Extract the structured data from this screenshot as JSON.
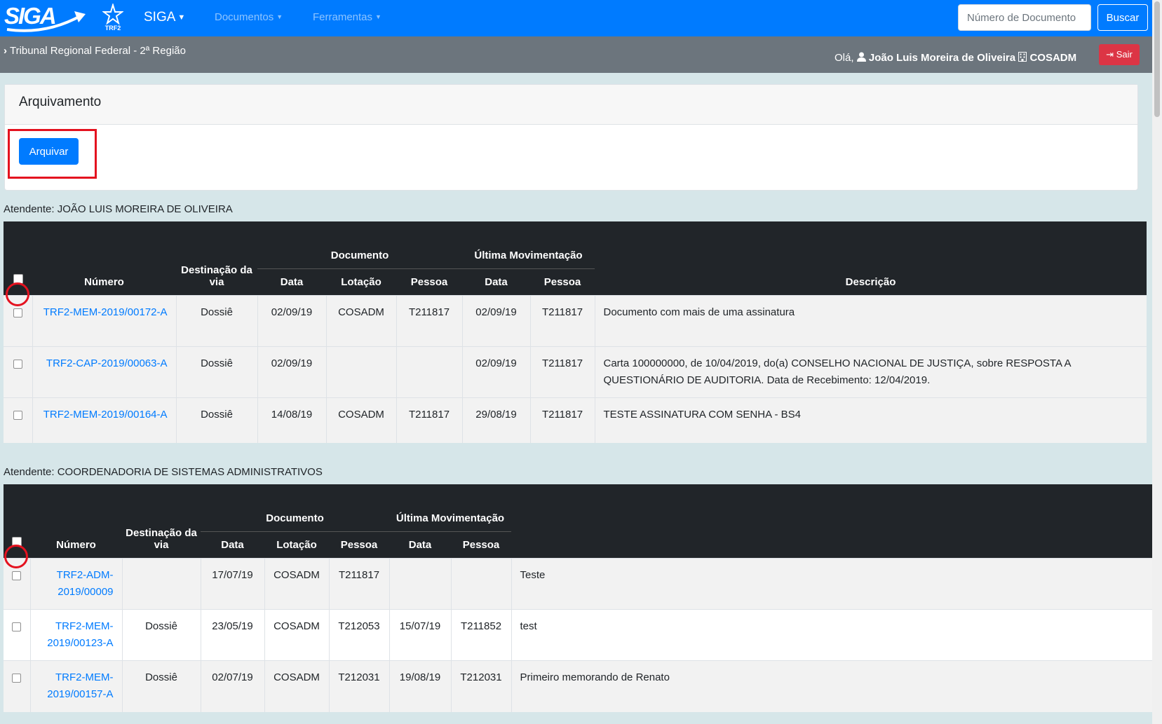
{
  "nav": {
    "logo_text": "SIGA",
    "trf2_label": "TRF2",
    "brand": "SIGA",
    "menu_documentos": "Documentos",
    "menu_ferramentas": "Ferramentas",
    "search_placeholder": "Número de Documento",
    "search_button": "Buscar"
  },
  "header": {
    "breadcrumb": "Tribunal Regional Federal - 2ª Região",
    "greeting": "Olá,",
    "user_name": "João Luis Moreira de Oliveira",
    "lotacao": "COSADM",
    "logout": "Sair"
  },
  "card": {
    "title": "Arquivamento",
    "button": "Arquivar"
  },
  "table_headers": {
    "numero": "Número",
    "destinacao": "Destinação da via",
    "documento": "Documento",
    "ultima_mov": "Última Movimentação",
    "data": "Data",
    "lotacao": "Lotação",
    "pessoa": "Pessoa",
    "descricao": "Descrição"
  },
  "group1": {
    "title": "Atendente: JOÃO LUIS MOREIRA DE OLIVEIRA",
    "rows": [
      {
        "numero": "TRF2-MEM-2019/00172-A",
        "destinacao": "Dossiê",
        "doc_data": "02/09/19",
        "doc_lotacao": "COSADM",
        "doc_pessoa": "T211817",
        "mov_data": "02/09/19",
        "mov_pessoa": "T211817",
        "descricao": "Documento com mais de uma assinatura"
      },
      {
        "numero": "TRF2-CAP-2019/00063-A",
        "destinacao": "Dossiê",
        "doc_data": "02/09/19",
        "doc_lotacao": "",
        "doc_pessoa": "",
        "mov_data": "02/09/19",
        "mov_pessoa": "T211817",
        "descricao": "Carta 100000000, de 10/04/2019, do(a) CONSELHO NACIONAL DE JUSTIÇA, sobre RESPOSTA A QUESTIONÁRIO DE AUDITORIA. Data de Recebimento: 12/04/2019."
      },
      {
        "numero": "TRF2-MEM-2019/00164-A",
        "destinacao": "Dossiê",
        "doc_data": "14/08/19",
        "doc_lotacao": "COSADM",
        "doc_pessoa": "T211817",
        "mov_data": "29/08/19",
        "mov_pessoa": "T211817",
        "descricao": "TESTE ASSINATURA COM SENHA - BS4"
      }
    ]
  },
  "group2": {
    "title": "Atendente: COORDENADORIA DE SISTEMAS ADMINISTRATIVOS",
    "rows": [
      {
        "numero": "TRF2-ADM-2019/00009",
        "destinacao": "",
        "doc_data": "17/07/19",
        "doc_lotacao": "COSADM",
        "doc_pessoa": "T211817",
        "mov_data": "",
        "mov_pessoa": "",
        "descricao": "Teste"
      },
      {
        "numero": "TRF2-MEM-2019/00123-A",
        "destinacao": "Dossiê",
        "doc_data": "23/05/19",
        "doc_lotacao": "COSADM",
        "doc_pessoa": "T212053",
        "mov_data": "15/07/19",
        "mov_pessoa": "T211852",
        "descricao": "test"
      },
      {
        "numero": "TRF2-MEM-2019/00157-A",
        "destinacao": "Dossiê",
        "doc_data": "02/07/19",
        "doc_lotacao": "COSADM",
        "doc_pessoa": "T212031",
        "mov_data": "19/08/19",
        "mov_pessoa": "T212031",
        "descricao": "Primeiro memorando de Renato"
      }
    ]
  }
}
